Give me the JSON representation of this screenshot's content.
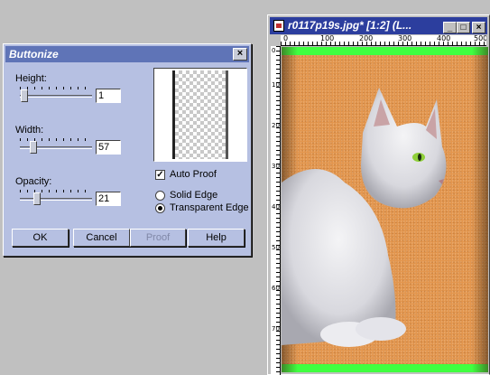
{
  "dialog": {
    "title": "Buttonize",
    "close_glyph": "×",
    "height": {
      "label": "Height:",
      "value": "1",
      "slider_fraction": 0.01
    },
    "width": {
      "label": "Width:",
      "value": "57",
      "slider_fraction": 0.15
    },
    "opacity": {
      "label": "Opacity:",
      "value": "21",
      "slider_fraction": 0.21
    },
    "auto_proof": {
      "label": "Auto Proof",
      "checked": true,
      "check_glyph": "✓"
    },
    "edge_options": [
      {
        "label": "Solid Edge",
        "selected": false
      },
      {
        "label": "Transparent Edge",
        "selected": true
      }
    ],
    "buttons": {
      "ok": "OK",
      "cancel": "Cancel",
      "proof": "Proof",
      "help": "Help"
    }
  },
  "image_window": {
    "title": "r0117p19s.jpg* [1:2] (L...",
    "controls": {
      "minimize": "_",
      "restore": "□",
      "close": "×"
    },
    "ruler_top_labels": [
      "0",
      "100",
      "200",
      "300",
      "400",
      "500"
    ],
    "ruler_left_labels": [
      "0",
      "100",
      "200",
      "300",
      "400",
      "500",
      "600",
      "700"
    ],
    "colors": {
      "background": "#e3964e",
      "band": "#40ff40",
      "title_bar": "#2c3e9e"
    }
  },
  "icons": [
    "close-icon",
    "document-icon",
    "minimize-icon",
    "restore-icon",
    "checkbox-check-icon",
    "radio-dot-icon",
    "cat-image"
  ]
}
